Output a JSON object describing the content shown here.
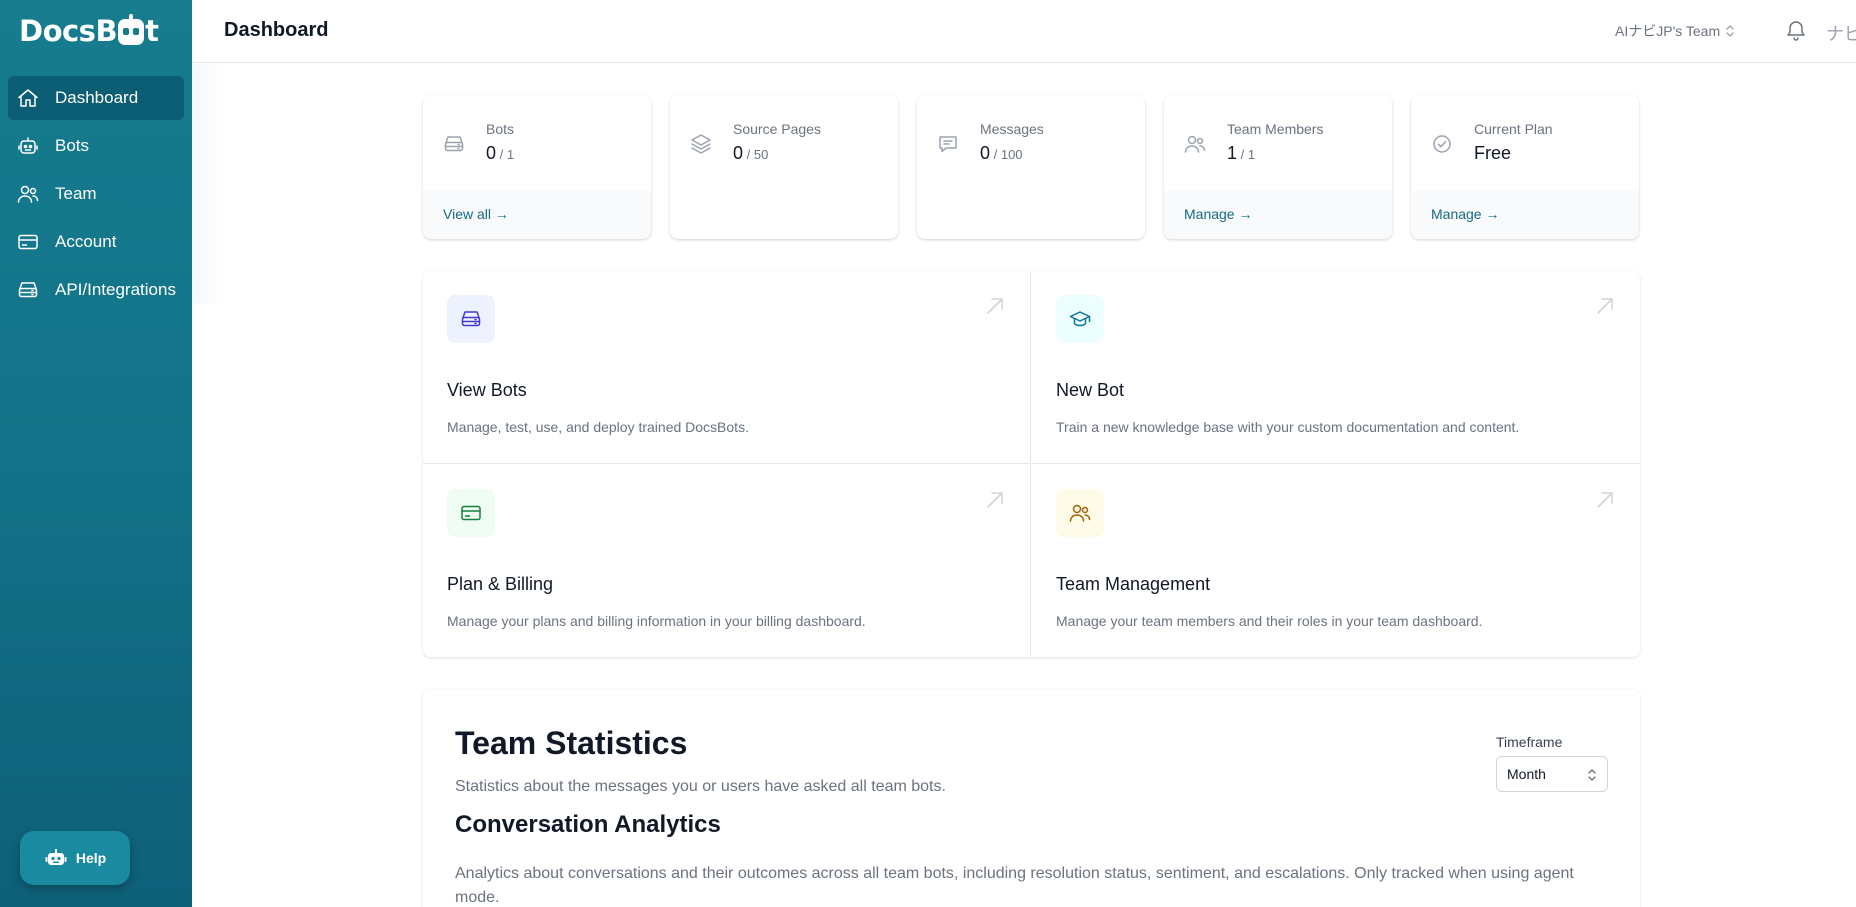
{
  "brand": {
    "name_part1": "Docs",
    "name_part2": "B",
    "name_part3": "t"
  },
  "sidebar": {
    "items": [
      {
        "label": "Dashboard",
        "icon": "home-icon",
        "active": true
      },
      {
        "label": "Bots",
        "icon": "robot-icon",
        "active": false
      },
      {
        "label": "Team",
        "icon": "users-icon",
        "active": false
      },
      {
        "label": "Account",
        "icon": "credit-card-icon",
        "active": false
      },
      {
        "label": "API/Integrations",
        "icon": "server-icon",
        "active": false
      }
    ],
    "help_label": "Help"
  },
  "header": {
    "title": "Dashboard",
    "team_name": "AIナビJP's Team",
    "avatar_text": "ナビ"
  },
  "stats": [
    {
      "label": "Bots",
      "value": "0",
      "limit": " / 1",
      "link": "View all →",
      "icon": "server-icon"
    },
    {
      "label": "Source Pages",
      "value": "0",
      "limit": " / 50",
      "link": "",
      "icon": "layers-icon"
    },
    {
      "label": "Messages",
      "value": "0",
      "limit": " / 100",
      "link": "",
      "icon": "chat-icon"
    },
    {
      "label": "Team Members",
      "value": "1",
      "limit": " / 1",
      "link": "Manage →",
      "icon": "users-icon"
    },
    {
      "label": "Current Plan",
      "value": "Free",
      "limit": "",
      "link": "Manage →",
      "icon": "check-badge-icon"
    }
  ],
  "actions": [
    {
      "title": "View Bots",
      "description": "Manage, test, use, and deploy trained DocsBots.",
      "icon": "server-icon",
      "icon_bg": "#eef2ff",
      "icon_color": "#4338ca"
    },
    {
      "title": "New Bot",
      "description": "Train a new knowledge base with your custom documentation and content.",
      "icon": "graduation-cap-icon",
      "icon_bg": "#ecfeff",
      "icon_color": "#0e7490"
    },
    {
      "title": "Plan & Billing",
      "description": "Manage your plans and billing information in your billing dashboard.",
      "icon": "credit-card-icon",
      "icon_bg": "#f0fdf4",
      "icon_color": "#15803d"
    },
    {
      "title": "Team Management",
      "description": "Manage your team members and their roles in your team dashboard.",
      "icon": "users-icon",
      "icon_bg": "#fefce8",
      "icon_color": "#a16207"
    }
  ],
  "team_statistics": {
    "title": "Team Statistics",
    "subtitle": "Statistics about the messages you or users have asked all team bots.",
    "timeframe_label": "Timeframe",
    "timeframe_value": "Month",
    "analytics_title": "Conversation Analytics",
    "analytics_subtitle": "Analytics about conversations and their outcomes across all team bots, including resolution status, sentiment, and escalations. Only tracked when using agent mode."
  },
  "colors": {
    "sidebar": "#137489",
    "accent": "#146b85"
  }
}
